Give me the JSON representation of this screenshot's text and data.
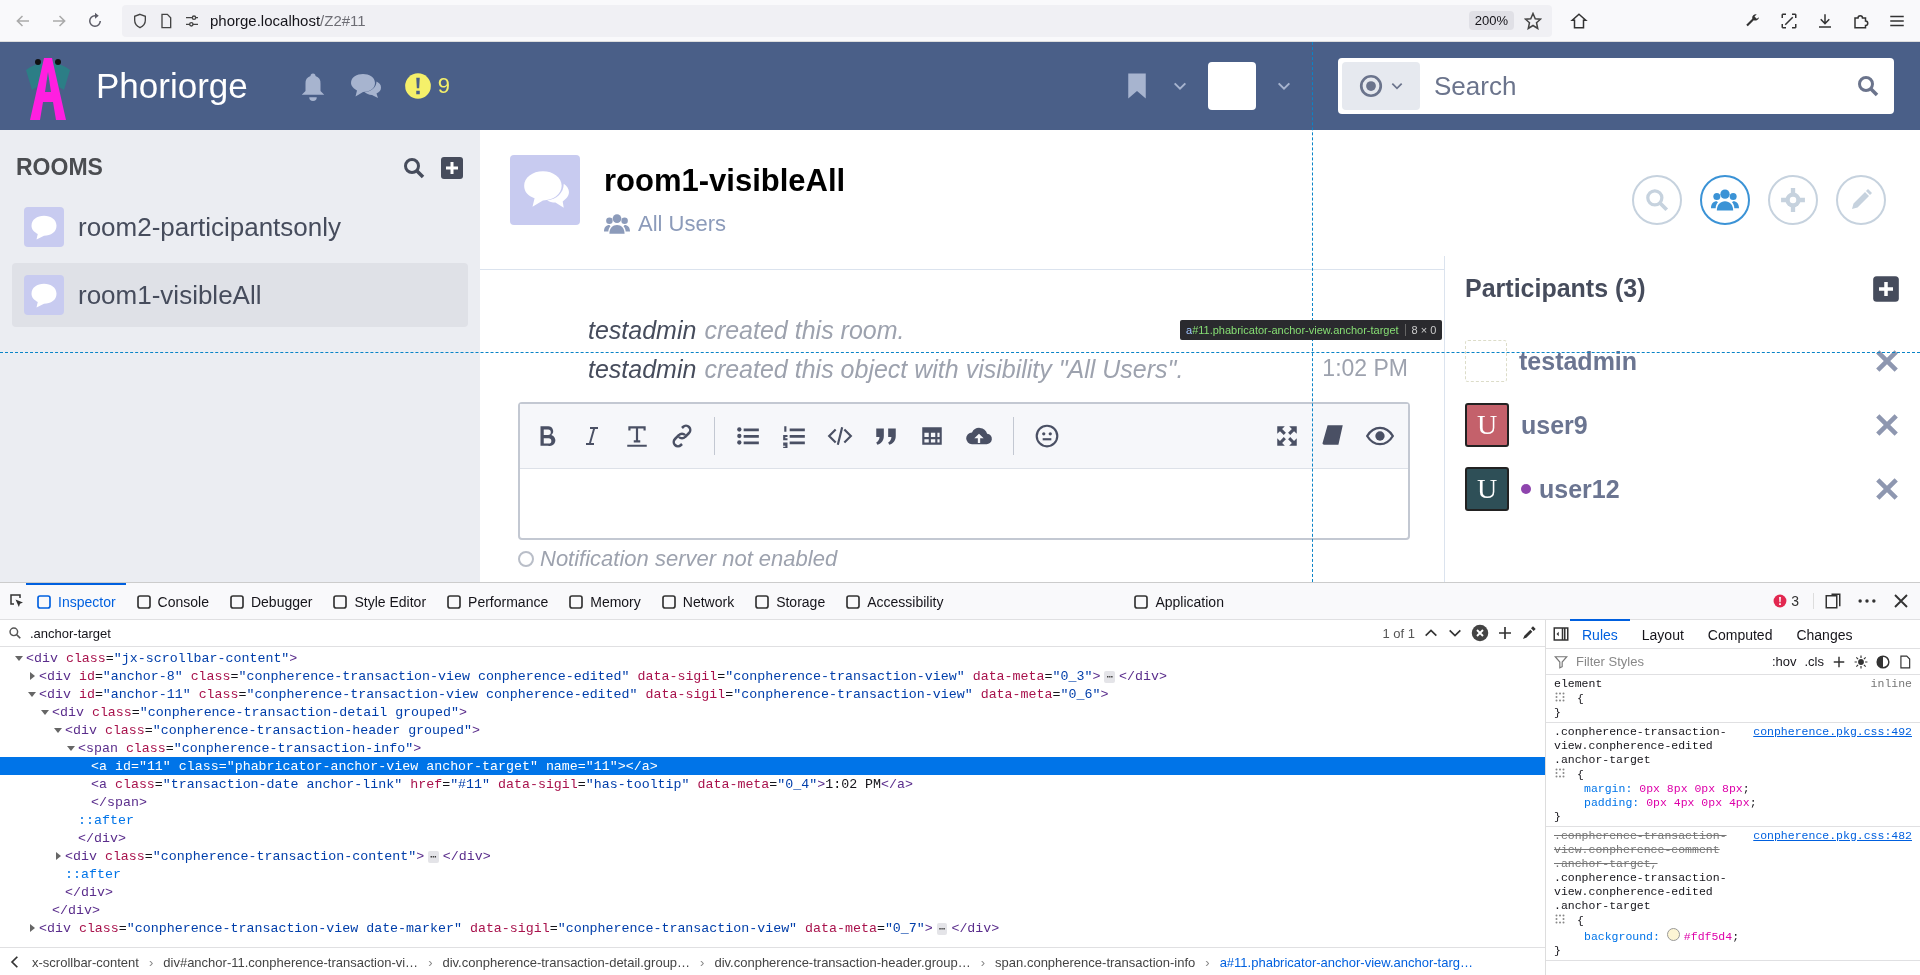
{
  "browser": {
    "url_host": "phorge.localhost",
    "url_path": "/Z2#11",
    "zoom": "200%"
  },
  "header": {
    "brand": "Phoriorge",
    "alert_count": "9",
    "search": {
      "placeholder": "Search"
    }
  },
  "sidebar": {
    "title": "ROOMS",
    "rooms": [
      {
        "name": "room2-participantsonly",
        "selected": false
      },
      {
        "name": "room1-visibleAll",
        "selected": true
      }
    ]
  },
  "room": {
    "title": "room1-visibleAll",
    "visibility": "All Users",
    "actions": [
      {
        "kind": "search",
        "selected": false
      },
      {
        "kind": "people",
        "selected": true
      },
      {
        "kind": "settings",
        "selected": false
      },
      {
        "kind": "edit",
        "selected": false
      }
    ]
  },
  "messages": [
    {
      "author": "testadmin",
      "text": "created this room."
    },
    {
      "author": "testadmin",
      "text": "created this object with visibility \"All Users\".",
      "time": "1:02 PM"
    }
  ],
  "editor": {
    "status": "Notification server not enabled"
  },
  "participants": {
    "title": "Participants (3)",
    "items": [
      {
        "name": "testadmin",
        "kind": "image",
        "color": "#ffffff",
        "online": false
      },
      {
        "name": "user9",
        "kind": "letter",
        "avatar": "U",
        "color": "#c4616b",
        "online": false
      },
      {
        "name": "user12",
        "kind": "letter",
        "avatar": "U",
        "color": "#2e4f57",
        "online": true
      }
    ]
  },
  "highlighter": {
    "selector_tag": "a",
    "selector_rest": "#11.phabricator-anchor-view.anchor-target",
    "size": "8 × 0"
  },
  "devtools": {
    "tabs": [
      {
        "label": "Inspector",
        "selected": true
      },
      {
        "label": "Console",
        "selected": false
      },
      {
        "label": "Debugger",
        "selected": false
      },
      {
        "label": "Style Editor",
        "selected": false
      },
      {
        "label": "Performance",
        "selected": false
      },
      {
        "label": "Memory",
        "selected": false
      },
      {
        "label": "Network",
        "selected": false
      },
      {
        "label": "Storage",
        "selected": false
      },
      {
        "label": "Accessibility",
        "selected": false
      },
      {
        "label": "Application",
        "selected": false
      }
    ],
    "error_count": "3",
    "search_value": ".anchor-target",
    "match_count": "1 of 1",
    "dom_tree": [
      {
        "text": "<div class=\"jx-scrollbar-content\">",
        "selected": false,
        "expanded": true,
        "children": [
          {
            "text": "<div id=\"anchor-8\" class=\"conpherence-transaction-view conpherence-edited\" data-sigil=\"conpherence-transaction-view\" data-meta=\"0_3\">",
            "more": "⋯",
            "closing": "</div>",
            "selected": false,
            "expanded": false
          },
          {
            "text": "<div id=\"anchor-11\" class=\"conpherence-transaction-view conpherence-edited\" data-sigil=\"conpherence-transaction-view\" data-meta=\"0_6\">",
            "selected": false,
            "expanded": true,
            "children": [
              {
                "text": "<div class=\"conpherence-transaction-detail grouped\">",
                "selected": false,
                "expanded": true,
                "children": [
                  {
                    "text": "<div class=\"conpherence-transaction-header grouped\">",
                    "selected": false,
                    "expanded": true,
                    "children": [
                      {
                        "text": "<span class=\"conpherence-transaction-info\">",
                        "selected": false,
                        "expanded": true,
                        "children": [
                          {
                            "text": "<a id=\"11\" class=\"phabricator-anchor-view anchor-target\" name=\"11\"></a>",
                            "selected": true
                          },
                          {
                            "text": "<a class=\"transaction-date anchor-link\" href=\"#11\" data-sigil=\"has-tooltip\" data-meta=\"0_4\">1:02 PM</a>",
                            "selected": false
                          },
                          {
                            "text": "</span>",
                            "selected": false
                          }
                        ]
                      },
                      {
                        "text": "::after",
                        "selected": false
                      },
                      {
                        "text": "</div>",
                        "selected": false
                      }
                    ]
                  },
                  {
                    "text": "<div class=\"conpherence-transaction-content\">",
                    "more": "⋯",
                    "closing": "</div>",
                    "selected": false,
                    "expanded": false
                  },
                  {
                    "text": "::after",
                    "selected": false
                  },
                  {
                    "text": "</div>",
                    "selected": false
                  }
                ]
              },
              {
                "text": "</div>",
                "selected": false
              }
            ]
          },
          {
            "text": "<div class=\"conpherence-transaction-view date-marker\" data-sigil=\"conpherence-transaction-view\" data-meta=\"0_7\">",
            "more": "⋯",
            "closing": "</div>",
            "selected": false,
            "expanded": false
          }
        ]
      }
    ],
    "breadcrumbs": [
      {
        "label": "x-scrollbar-content",
        "selected": false
      },
      {
        "separator": "›",
        "label": "div#anchor-11.conpherence-transaction-vi…",
        "selected": false
      },
      {
        "separator": "›",
        "label": "div.conpherence-transaction-detail.group…",
        "selected": false
      },
      {
        "separator": "›",
        "label": "div.conpherence-transaction-header.group…",
        "selected": false
      },
      {
        "separator": "›",
        "label": "span.conpherence-transaction-info",
        "selected": false
      },
      {
        "separator": "›",
        "label": "a#11.phabricator-anchor-view.anchor-targ…",
        "selected": true
      }
    ],
    "side_tabs": [
      {
        "label": "Rules",
        "selected": true
      },
      {
        "label": "Layout",
        "selected": false
      },
      {
        "label": "Computed",
        "selected": false
      },
      {
        "label": "Changes",
        "selected": false
      }
    ],
    "filter_placeholder": "Filter Styles",
    "pseudo_toggle": ":hov",
    "class_toggle": ".cls",
    "rules": [
      {
        "kind": "inline",
        "selector": "element",
        "open_brace": "{",
        "close_brace": "}",
        "source": "inline"
      },
      {
        "kind": "stylesheet",
        "selector": ".conpherence-transaction-view.conpherence-edited .anchor-target",
        "open_brace": "{",
        "close_brace": "}",
        "source": "conpherence.pkg.css:492",
        "declarations": [
          {
            "property": "margin",
            "colon": ":",
            "value": "0px 8px 0px 8px",
            "semicolon": ";"
          },
          {
            "property": "padding",
            "colon": ":",
            "value": "0px 4px 0px 4px",
            "semicolon": ";"
          }
        ]
      },
      {
        "kind": "stylesheet",
        "struck_selector": ".conpherence-transaction-view.conpherence-comment .anchor-target,",
        "selector": ".conpherence-transaction-view.conpherence-edited .anchor-target",
        "open_brace": "{",
        "close_brace": "}",
        "source": "conpherence.pkg.css:482",
        "declarations": [
          {
            "property": "background",
            "colon": ":",
            "value": "#fdf5d4",
            "semicolon": ";",
            "swatch": true
          }
        ]
      }
    ]
  }
}
